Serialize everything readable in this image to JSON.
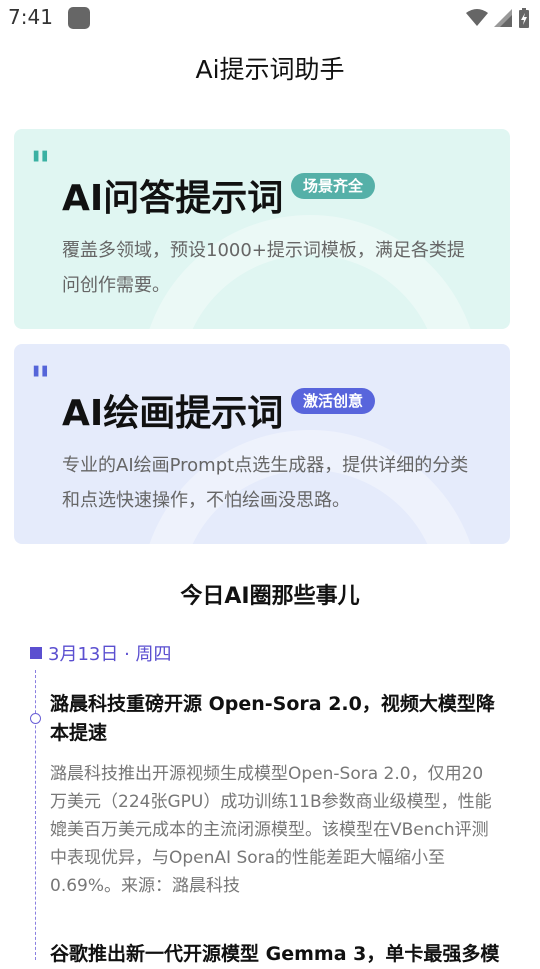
{
  "status_bar": {
    "time": "7:41",
    "icons": [
      "app-icon",
      "wifi-icon",
      "signal-icon",
      "battery-icon"
    ]
  },
  "app": {
    "title": "Ai提示词助手"
  },
  "cards": [
    {
      "title": "AI问答提示词",
      "badge": "场景齐全",
      "description": "覆盖多领域，预设1000+提示词模板，满足各类提问创作需要。",
      "accent": "#3ab1a3",
      "background": "#e0f6f2"
    },
    {
      "title": "AI绘画提示词",
      "badge": "激活创意",
      "description": "专业的AI绘画Prompt点选生成器，提供详细的分类和点选快速操作，不怕绘画没思路。",
      "accent": "#5565d9",
      "background": "#e5ebfb"
    }
  ],
  "news": {
    "section_title": "今日AI圈那些事儿",
    "date": "3月13日 · 周四",
    "date_color": "#5b4fd0",
    "items": [
      {
        "title": "潞晨科技重磅开源 Open-Sora 2.0，视频大模型降本提速",
        "body": "潞晨科技推出开源视频生成模型Open-Sora 2.0，仅用20万美元（224张GPU）成功训练11B参数商业级模型，性能媲美百万美元成本的主流闭源模型。该模型在VBench评测中表现优异，与OpenAI Sora的性能差距大幅缩小至0.69%。来源：潞晨科技"
      },
      {
        "title": "谷歌推出新一代开源模型 Gemma 3，单卡最强多模"
      }
    ]
  }
}
